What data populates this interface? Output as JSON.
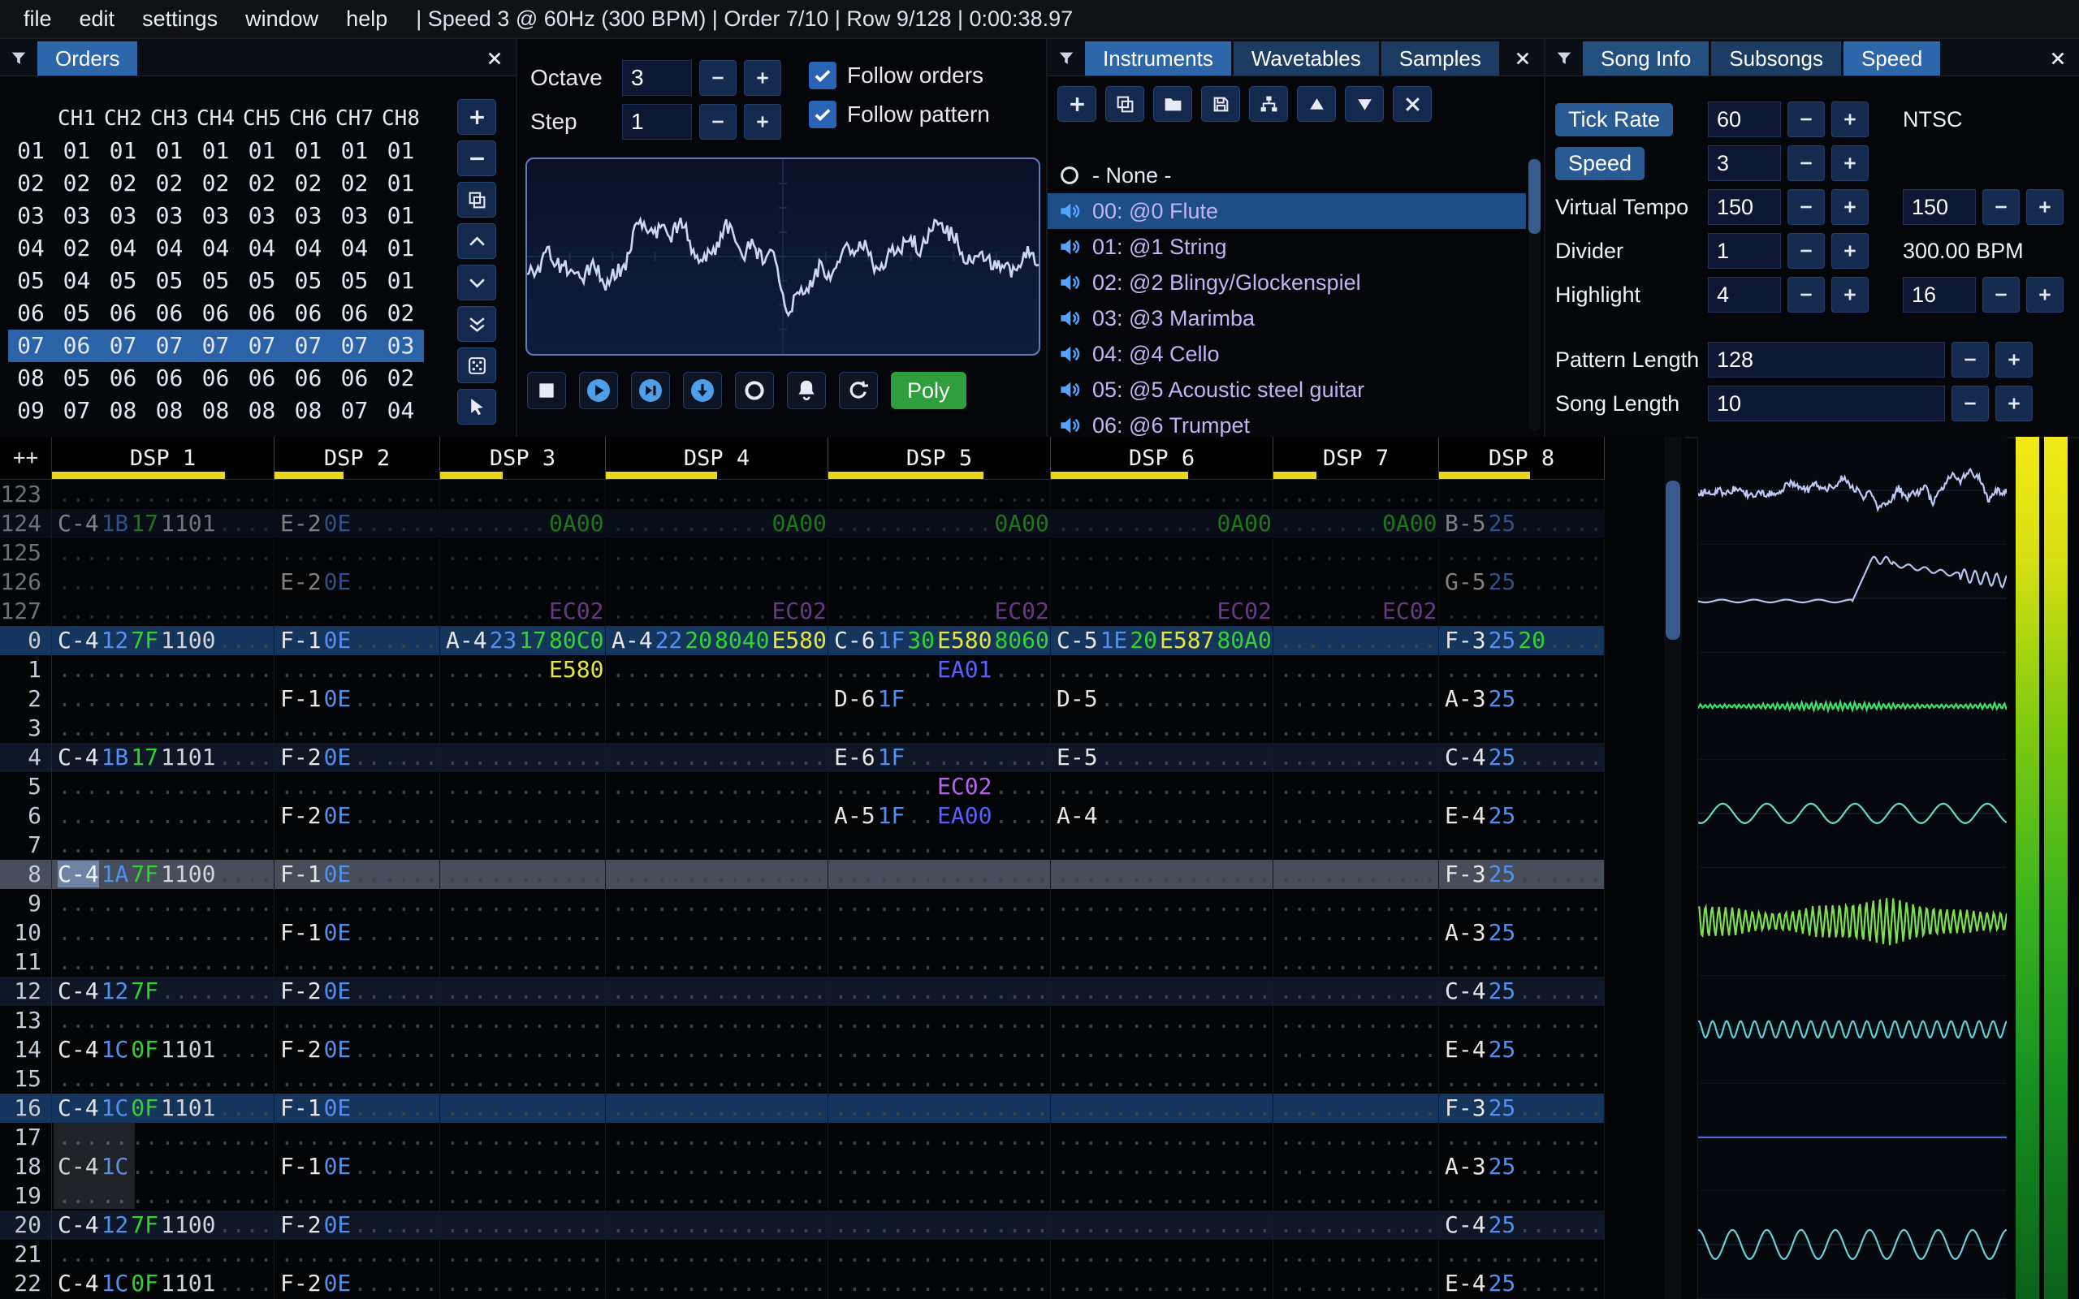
{
  "window": {
    "menu": [
      "file",
      "edit",
      "settings",
      "window",
      "help"
    ],
    "status": "| Speed 3 @ 60Hz (300 BPM) | Order 7/10 | Row 9/128 | 0:00:38.97"
  },
  "orders": {
    "title": "Orders",
    "columns": [
      "CH1",
      "CH2",
      "CH3",
      "CH4",
      "CH5",
      "CH6",
      "CH7",
      "CH8"
    ],
    "rows": [
      {
        "label": "01",
        "values": [
          "01",
          "01",
          "01",
          "01",
          "01",
          "01",
          "01",
          "01"
        ]
      },
      {
        "label": "02",
        "values": [
          "02",
          "02",
          "02",
          "02",
          "02",
          "02",
          "02",
          "01"
        ]
      },
      {
        "label": "03",
        "values": [
          "03",
          "03",
          "03",
          "03",
          "03",
          "03",
          "03",
          "01"
        ]
      },
      {
        "label": "04",
        "values": [
          "02",
          "04",
          "04",
          "04",
          "04",
          "04",
          "04",
          "01"
        ]
      },
      {
        "label": "05",
        "values": [
          "04",
          "05",
          "05",
          "05",
          "05",
          "05",
          "05",
          "01"
        ]
      },
      {
        "label": "06",
        "values": [
          "05",
          "06",
          "06",
          "06",
          "06",
          "06",
          "06",
          "02"
        ]
      },
      {
        "label": "07",
        "values": [
          "06",
          "07",
          "07",
          "07",
          "07",
          "07",
          "07",
          "03"
        ],
        "selected": true
      },
      {
        "label": "08",
        "values": [
          "05",
          "06",
          "06",
          "06",
          "06",
          "06",
          "06",
          "02"
        ]
      },
      {
        "label": "09",
        "values": [
          "07",
          "08",
          "08",
          "08",
          "08",
          "08",
          "07",
          "04"
        ]
      }
    ],
    "toolbar": [
      {
        "name": "order-add",
        "icon": "plus"
      },
      {
        "name": "order-remove",
        "icon": "minus"
      },
      {
        "name": "order-duplicate",
        "icon": "copy"
      },
      {
        "name": "order-move-up",
        "icon": "chev-up"
      },
      {
        "name": "order-move-down",
        "icon": "chev-down"
      },
      {
        "name": "order-duplicate-end",
        "icon": "dchev-down"
      },
      {
        "name": "order-random",
        "icon": "dice"
      },
      {
        "name": "order-edit-mode",
        "icon": "cursor"
      }
    ]
  },
  "transport": {
    "octave_label": "Octave",
    "octave": "3",
    "step_label": "Step",
    "step": "1",
    "follow_orders_label": "Follow orders",
    "follow_orders_checked": true,
    "follow_pattern_label": "Follow pattern",
    "follow_pattern_checked": true,
    "scope": {
      "type": "noisy",
      "amp": 0.6,
      "seed": 21,
      "color": "#ccd6f4"
    },
    "playback": [
      {
        "name": "stop",
        "icon": "stop"
      },
      {
        "name": "play",
        "icon": "play-circle"
      },
      {
        "name": "play-pattern",
        "icon": "next-circle"
      },
      {
        "name": "step-row",
        "icon": "step-circle"
      },
      {
        "name": "record",
        "icon": "record"
      },
      {
        "name": "metronome",
        "icon": "bell"
      },
      {
        "name": "repeat",
        "icon": "repeat"
      },
      {
        "name": "poly",
        "type": "button",
        "label": "Poly"
      }
    ]
  },
  "instruments": {
    "tabs": [
      {
        "label": "Instruments",
        "active": true
      },
      {
        "label": "Wavetables"
      },
      {
        "label": "Samples"
      }
    ],
    "toolbar": [
      {
        "name": "instrument-add",
        "icon": "plus"
      },
      {
        "name": "instrument-duplicate",
        "icon": "copy"
      },
      {
        "name": "instrument-open",
        "icon": "folder"
      },
      {
        "name": "instrument-save",
        "icon": "disk"
      },
      {
        "name": "instrument-folders",
        "icon": "tree"
      },
      {
        "name": "instrument-move-up",
        "icon": "tri-up"
      },
      {
        "name": "instrument-move-down",
        "icon": "tri-down"
      },
      {
        "name": "instrument-delete",
        "icon": "x"
      }
    ],
    "items": [
      {
        "label": "- None -",
        "icon": "circle",
        "none": true
      },
      {
        "label": "00: @0 Flute",
        "icon": "speaker",
        "selected": true
      },
      {
        "label": "01: @1 String",
        "icon": "speaker"
      },
      {
        "label": "02: @2 Blingy/Glockenspiel",
        "icon": "speaker"
      },
      {
        "label": "03: @3 Marimba",
        "icon": "speaker"
      },
      {
        "label": "04: @4 Cello",
        "icon": "speaker"
      },
      {
        "label": "05: @5 Acoustic steel guitar",
        "icon": "speaker"
      },
      {
        "label": "06: @6 Trumpet",
        "icon": "speaker"
      }
    ]
  },
  "song": {
    "tabs": [
      {
        "label": "Song Info",
        "semi": true
      },
      {
        "label": "Subsongs"
      },
      {
        "label": "Speed",
        "active": true
      }
    ],
    "fields": {
      "tick_rate_label": "Tick Rate",
      "tick_rate": "60",
      "tick_rate_mode": "NTSC",
      "speed_label": "Speed",
      "speed": "3",
      "virtual_tempo_label": "Virtual Tempo",
      "virtual_tempo": "150",
      "virtual_tempo_divisor": "150",
      "divider_label": "Divider",
      "divider": "1",
      "bpm": "300.00 BPM",
      "highlight_label": "Highlight",
      "highlight_first": "4",
      "highlight_second": "16",
      "pattern_length_label": "Pattern Length",
      "pattern_length": "128",
      "song_length_label": "Song Length",
      "song_length": "10"
    }
  },
  "pattern": {
    "corner": "++",
    "channels": [
      {
        "name": "DSP 1",
        "fx": 2,
        "vu": 0.78
      },
      {
        "name": "DSP 2",
        "fx": 1,
        "vu": 0.42
      },
      {
        "name": "DSP 3",
        "fx": 1,
        "vu": 0.38
      },
      {
        "name": "DSP 4",
        "fx": 2,
        "vu": 0.5
      },
      {
        "name": "DSP 5",
        "fx": 2,
        "vu": 0.7
      },
      {
        "name": "DSP 6",
        "fx": 2,
        "vu": 0.62
      },
      {
        "name": "DSP 7",
        "fx": 1,
        "vu": 0.26
      },
      {
        "name": "DSP 8",
        "fx": 1,
        "vu": 0.55
      }
    ],
    "rows": [
      {
        "n": "123",
        "dim": true
      },
      {
        "n": "124",
        "dim": true,
        "hl": 1,
        "cells": [
          {
            "note": "C-4",
            "ins": "1B",
            "vol": "17",
            "fx": [
              [
                "1101",
                "e1"
              ]
            ]
          },
          {
            "note": "E-2",
            "ins": "0E"
          },
          {
            "fx": [
              [
                "0A00",
                "eg"
              ]
            ]
          },
          {
            "fx": [
              null,
              [
                "0A00",
                "eg"
              ]
            ]
          },
          {
            "fx": [
              null,
              [
                "0A00",
                "eg"
              ]
            ]
          },
          {
            "fx": [
              null,
              [
                "0A00",
                "eg"
              ]
            ]
          },
          {
            "fx": [
              [
                "0A00",
                "eg"
              ]
            ]
          },
          {
            "note": "B-5",
            "ins": "25"
          }
        ]
      },
      {
        "n": "125",
        "dim": true
      },
      {
        "n": "126",
        "dim": true,
        "cells": [
          null,
          {
            "note": "E-2",
            "ins": "0E"
          },
          null,
          null,
          null,
          null,
          null,
          {
            "note": "G-5",
            "ins": "25"
          }
        ]
      },
      {
        "n": "127",
        "dim": true,
        "cells": [
          null,
          null,
          {
            "fx": [
              [
                "EC02",
                "ep"
              ]
            ]
          },
          {
            "fx": [
              null,
              [
                "EC02",
                "ep"
              ]
            ]
          },
          {
            "fx": [
              null,
              [
                "EC02",
                "ep"
              ]
            ]
          },
          {
            "fx": [
              null,
              [
                "EC02",
                "ep"
              ]
            ]
          },
          {
            "fx": [
              [
                "EC02",
                "ep"
              ]
            ]
          },
          null
        ]
      },
      {
        "n": "0",
        "hl": 2,
        "cells": [
          {
            "note": "C-4",
            "ins": "12",
            "vol": "7F",
            "fx": [
              [
                "1100",
                "e1"
              ]
            ]
          },
          {
            "note": "F-1",
            "ins": "0E"
          },
          {
            "note": "A-4",
            "ins": "23",
            "vol": "17",
            "fx": [
              [
                "80C0",
                "eg"
              ]
            ]
          },
          {
            "note": "A-4",
            "ins": "22",
            "vol": "20",
            "fx": [
              [
                "8040",
                "eg"
              ],
              [
                "E580",
                "ey"
              ]
            ]
          },
          {
            "note": "C-6",
            "ins": "1F",
            "vol": "30",
            "fx": [
              [
                "E580",
                "ey"
              ],
              [
                "8060",
                "eg"
              ]
            ]
          },
          {
            "note": "C-5",
            "ins": "1E",
            "vol": "20",
            "fx": [
              [
                "E587",
                "ey"
              ],
              [
                "80A0",
                "eg"
              ]
            ]
          },
          null,
          {
            "note": "F-3",
            "ins": "25",
            "vol": "20"
          }
        ]
      },
      {
        "n": "1",
        "cells": [
          null,
          null,
          {
            "fx": [
              [
                "E580",
                "ey"
              ]
            ]
          },
          null,
          {
            "fx": [
              [
                "EA01",
                "eb"
              ]
            ]
          },
          null,
          null,
          null
        ]
      },
      {
        "n": "2",
        "cells": [
          null,
          {
            "note": "F-1",
            "ins": "0E"
          },
          null,
          null,
          {
            "note": "D-6",
            "ins": "1F"
          },
          {
            "note": "D-5"
          },
          null,
          {
            "note": "A-3",
            "ins": "25"
          }
        ]
      },
      {
        "n": "3"
      },
      {
        "n": "4",
        "hl": 1,
        "cells": [
          {
            "note": "C-4",
            "ins": "1B",
            "vol": "17",
            "fx": [
              [
                "1101",
                "e1"
              ]
            ]
          },
          {
            "note": "F-2",
            "ins": "0E"
          },
          null,
          null,
          {
            "note": "E-6",
            "ins": "1F"
          },
          {
            "note": "E-5"
          },
          null,
          {
            "note": "C-4",
            "ins": "25"
          }
        ]
      },
      {
        "n": "5",
        "cells": [
          null,
          null,
          null,
          null,
          {
            "fx": [
              [
                "EC02",
                "ep"
              ]
            ]
          },
          null,
          null,
          null
        ]
      },
      {
        "n": "6",
        "cells": [
          null,
          {
            "note": "F-2",
            "ins": "0E"
          },
          null,
          null,
          {
            "note": "A-5",
            "ins": "1F",
            "fx": [
              [
                "EA00",
                "eb"
              ]
            ]
          },
          {
            "note": "A-4"
          },
          null,
          {
            "note": "E-4",
            "ins": "25"
          }
        ]
      },
      {
        "n": "7"
      },
      {
        "n": "8",
        "hl": 1,
        "play": true,
        "cursor": [
          0
        ],
        "cells": [
          {
            "note": "C-4",
            "ins": "1A",
            "vol": "7F",
            "fx": [
              [
                "1100",
                "e1"
              ]
            ]
          },
          {
            "note": "F-1",
            "ins": "0E"
          },
          null,
          null,
          null,
          null,
          null,
          {
            "note": "F-3",
            "ins": "25"
          }
        ]
      },
      {
        "n": "9"
      },
      {
        "n": "10",
        "cells": [
          null,
          {
            "note": "F-1",
            "ins": "0E"
          },
          null,
          null,
          null,
          null,
          null,
          {
            "note": "A-3",
            "ins": "25"
          }
        ]
      },
      {
        "n": "11"
      },
      {
        "n": "12",
        "hl": 1,
        "cells": [
          {
            "note": "C-4",
            "ins": "12",
            "vol": "7F"
          },
          {
            "note": "F-2",
            "ins": "0E"
          },
          null,
          null,
          null,
          null,
          null,
          {
            "note": "C-4",
            "ins": "25"
          }
        ]
      },
      {
        "n": "13"
      },
      {
        "n": "14",
        "cells": [
          {
            "note": "C-4",
            "ins": "1C",
            "vol": "0F",
            "fx": [
              [
                "1101",
                "e1"
              ]
            ]
          },
          {
            "note": "F-2",
            "ins": "0E"
          },
          null,
          null,
          null,
          null,
          null,
          {
            "note": "E-4",
            "ins": "25"
          }
        ]
      },
      {
        "n": "15"
      },
      {
        "n": "16",
        "hl": 2,
        "cells": [
          {
            "note": "C-4",
            "ins": "1C",
            "vol": "0F",
            "fx": [
              [
                "1101",
                "e1"
              ]
            ]
          },
          {
            "note": "F-1",
            "ins": "0E"
          },
          null,
          null,
          null,
          null,
          null,
          {
            "note": "F-3",
            "ins": "25"
          }
        ]
      },
      {
        "n": "17"
      },
      {
        "n": "18",
        "cells": [
          {
            "note": "C-4",
            "ins": "1C"
          },
          {
            "note": "F-1",
            "ins": "0E"
          },
          null,
          null,
          null,
          null,
          null,
          {
            "note": "A-3",
            "ins": "25"
          }
        ]
      },
      {
        "n": "19"
      },
      {
        "n": "20",
        "hl": 1,
        "cells": [
          {
            "note": "C-4",
            "ins": "12",
            "vol": "7F",
            "fx": [
              [
                "1100",
                "e1"
              ]
            ]
          },
          {
            "note": "F-2",
            "ins": "0E"
          },
          null,
          null,
          null,
          null,
          null,
          {
            "note": "C-4",
            "ins": "25"
          }
        ]
      },
      {
        "n": "21"
      },
      {
        "n": "22",
        "cells": [
          {
            "note": "C-4",
            "ins": "1C",
            "vol": "0F",
            "fx": [
              [
                "1101",
                "e1"
              ]
            ]
          },
          {
            "note": "F-2",
            "ins": "0E"
          },
          null,
          null,
          null,
          null,
          null,
          {
            "note": "E-4",
            "ins": "25"
          }
        ]
      }
    ]
  },
  "scopes": {
    "channels": [
      {
        "name": "DSP 1",
        "type": "noisy",
        "color": "#bcc8f2",
        "amp": 0.5,
        "seed": 3
      },
      {
        "name": "DSP 2",
        "type": "env",
        "color": "#b2c4f0",
        "amp": 0.95,
        "seed": 5
      },
      {
        "name": "DSP 3",
        "type": "zig",
        "color": "#3fe06a",
        "amp": 0.09,
        "freq": 64,
        "seed": 7
      },
      {
        "name": "DSP 4",
        "type": "sine",
        "color": "#66d8c8",
        "amp": 0.2,
        "freq": 7,
        "seed": 9
      },
      {
        "name": "DSP 5",
        "type": "zig",
        "color": "#7cdf4e",
        "amp": 0.5,
        "freq": 46,
        "seed": 11
      },
      {
        "name": "DSP 6",
        "type": "sine",
        "color": "#5cd0d8",
        "amp": 0.17,
        "freq": 22,
        "seed": 13
      },
      {
        "name": "DSP 7",
        "type": "flat",
        "color": "#4468e0",
        "amp": 0,
        "seed": 15
      },
      {
        "name": "DSP 8",
        "type": "sine",
        "color": "#66d0d8",
        "amp": 0.3,
        "freq": 9,
        "seed": 17
      }
    ]
  },
  "meter": {
    "colors": [
      "#f2ea16",
      "#9ed40e",
      "#3cb51e",
      "#15801a",
      "#0b5c12"
    ]
  },
  "colors": {
    "accent": "#2e66aa",
    "tab_inactive": "#1c3c63",
    "note": "#e6e6e6",
    "instrument": "#5290f0",
    "volume": "#2fd42f",
    "fx_misc": "#d0d4d8",
    "fx_green": "#2fd42f",
    "fx_yellow": "#e6e642",
    "fx_purple": "#b863f0",
    "fx_blue": "#5560ff",
    "row_hl1": "#0f1626",
    "row_hl2": "#16355c",
    "playhead": "#474e59",
    "vu_meter": "#ecd51e"
  }
}
